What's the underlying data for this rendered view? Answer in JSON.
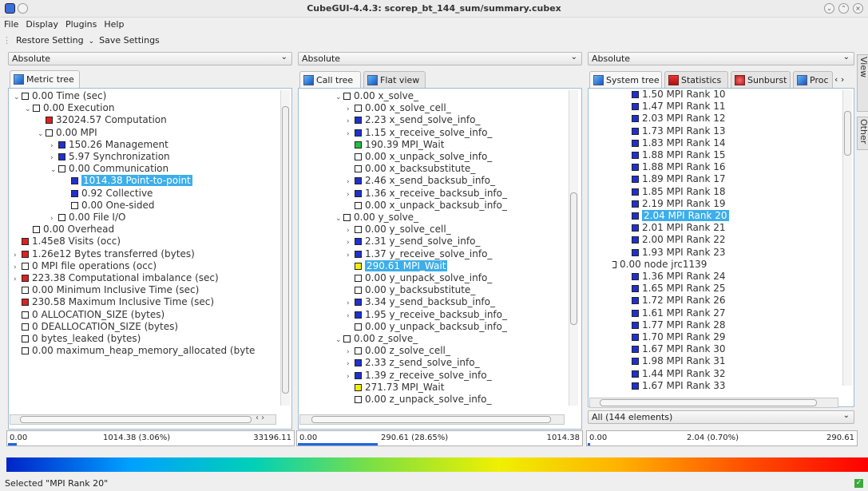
{
  "window": {
    "title": "CubeGUI-4.4.3: scorep_bt_144_sum/summary.cubex"
  },
  "menu": [
    "File",
    "Display",
    "Plugins",
    "Help"
  ],
  "toolbar": {
    "restore": "Restore Setting",
    "save": "Save Settings"
  },
  "left": {
    "selector": "Absolute",
    "tab": "Metric tree",
    "rows": [
      {
        "e": "⌄",
        "c": "#fff",
        "t": "0.00 Time (sec)"
      },
      {
        "e": "⌄",
        "c": "#fff",
        "t": "0.00 Execution"
      },
      {
        "e": "",
        "c": "#e02020",
        "t": "32024.57 Computation"
      },
      {
        "e": "⌄",
        "c": "#fff",
        "t": "0.00 MPI"
      },
      {
        "e": "›",
        "c": "#2030d0",
        "t": "150.26 Management"
      },
      {
        "e": "›",
        "c": "#2030d0",
        "t": "5.97 Synchronization"
      },
      {
        "e": "⌄",
        "c": "#fff",
        "t": "0.00 Communication"
      },
      {
        "e": "",
        "c": "#2030d0",
        "t": "1014.38 Point-to-point",
        "sel": true
      },
      {
        "e": "",
        "c": "#2030d0",
        "t": "0.92 Collective"
      },
      {
        "e": "",
        "c": "#fff",
        "t": "0.00 One-sided"
      },
      {
        "e": "›",
        "c": "#fff",
        "t": "0.00 File I/O"
      },
      {
        "e": "",
        "c": "#fff",
        "t": "0.00 Overhead"
      },
      {
        "e": "",
        "c": "#e02020",
        "t": "1.45e8 Visits (occ)"
      },
      {
        "e": "›",
        "c": "#e02020",
        "t": "1.26e12 Bytes transferred (bytes)"
      },
      {
        "e": "›",
        "c": "#fff",
        "t": "0 MPI file operations (occ)"
      },
      {
        "e": "›",
        "c": "#e02020",
        "t": "223.38 Computational imbalance (sec)"
      },
      {
        "e": "",
        "c": "#fff",
        "t": "0.00 Minimum Inclusive Time (sec)"
      },
      {
        "e": "",
        "c": "#e02020",
        "t": "230.58 Maximum Inclusive Time (sec)"
      },
      {
        "e": "",
        "c": "#fff",
        "t": "0 ALLOCATION_SIZE (bytes)"
      },
      {
        "e": "",
        "c": "#fff",
        "t": "0 DEALLOCATION_SIZE (bytes)"
      },
      {
        "e": "",
        "c": "#fff",
        "t": "0 bytes_leaked (bytes)"
      },
      {
        "e": "",
        "c": "#fff",
        "t": "0.00 maximum_heap_memory_allocated (byte"
      }
    ],
    "bar": {
      "min": "0.00",
      "mid": "1014.38 (3.06%)",
      "max": "33196.11"
    }
  },
  "middle": {
    "selector": "Absolute",
    "tabs": [
      "Call tree",
      "Flat view"
    ],
    "rows": [
      {
        "e": "⌄",
        "c": "#fff",
        "t": "0.00 x_solve_"
      },
      {
        "e": "›",
        "c": "#fff",
        "t": "0.00 x_solve_cell_"
      },
      {
        "e": "›",
        "c": "#2030d0",
        "t": "2.23 x_send_solve_info_"
      },
      {
        "e": "›",
        "c": "#2030d0",
        "t": "1.15 x_receive_solve_info_"
      },
      {
        "e": "",
        "c": "#20c040",
        "t": "190.39 MPI_Wait"
      },
      {
        "e": "",
        "c": "#fff",
        "t": "0.00 x_unpack_solve_info_"
      },
      {
        "e": "",
        "c": "#fff",
        "t": "0.00 x_backsubstitute_"
      },
      {
        "e": "›",
        "c": "#2030d0",
        "t": "2.46 x_send_backsub_info_"
      },
      {
        "e": "›",
        "c": "#2030d0",
        "t": "1.36 x_receive_backsub_info_"
      },
      {
        "e": "",
        "c": "#fff",
        "t": "0.00 x_unpack_backsub_info_"
      },
      {
        "e": "⌄",
        "c": "#fff",
        "t": "0.00 y_solve_"
      },
      {
        "e": "›",
        "c": "#fff",
        "t": "0.00 y_solve_cell_"
      },
      {
        "e": "›",
        "c": "#2030d0",
        "t": "2.31 y_send_solve_info_"
      },
      {
        "e": "›",
        "c": "#2030d0",
        "t": "1.37 y_receive_solve_info_"
      },
      {
        "e": "",
        "c": "#f0f000",
        "t": "290.61 MPI_Wait",
        "sel": true
      },
      {
        "e": "",
        "c": "#fff",
        "t": "0.00 y_unpack_solve_info_"
      },
      {
        "e": "",
        "c": "#fff",
        "t": "0.00 y_backsubstitute_"
      },
      {
        "e": "›",
        "c": "#2030d0",
        "t": "3.34 y_send_backsub_info_"
      },
      {
        "e": "›",
        "c": "#2030d0",
        "t": "1.95 y_receive_backsub_info_"
      },
      {
        "e": "",
        "c": "#fff",
        "t": "0.00 y_unpack_backsub_info_"
      },
      {
        "e": "⌄",
        "c": "#fff",
        "t": "0.00 z_solve_"
      },
      {
        "e": "›",
        "c": "#fff",
        "t": "0.00 z_solve_cell_"
      },
      {
        "e": "›",
        "c": "#2030d0",
        "t": "2.33 z_send_solve_info_"
      },
      {
        "e": "›",
        "c": "#2030d0",
        "t": "1.39 z_receive_solve_info_"
      },
      {
        "e": "",
        "c": "#f0f000",
        "t": "271.73 MPI_Wait"
      },
      {
        "e": "",
        "c": "#fff",
        "t": "0.00 z_unpack_solve_info_"
      }
    ],
    "bar": {
      "min": "0.00",
      "mid": "290.61 (28.65%)",
      "max": "1014.38"
    }
  },
  "right": {
    "selector": "Absolute",
    "tabs": [
      "System tree",
      "Statistics",
      "Sunburst",
      "Proc"
    ],
    "rows": [
      {
        "e": "",
        "c": "#2030d0",
        "t": "1.50 MPI Rank 10"
      },
      {
        "e": "",
        "c": "#2030d0",
        "t": "1.47 MPI Rank 11"
      },
      {
        "e": "",
        "c": "#2030d0",
        "t": "2.03 MPI Rank 12"
      },
      {
        "e": "",
        "c": "#2030d0",
        "t": "1.73 MPI Rank 13"
      },
      {
        "e": "",
        "c": "#2030d0",
        "t": "1.83 MPI Rank 14"
      },
      {
        "e": "",
        "c": "#2030d0",
        "t": "1.88 MPI Rank 15"
      },
      {
        "e": "",
        "c": "#2030d0",
        "t": "1.88 MPI Rank 16"
      },
      {
        "e": "",
        "c": "#2030d0",
        "t": "1.89 MPI Rank 17"
      },
      {
        "e": "",
        "c": "#2030d0",
        "t": "1.85 MPI Rank 18"
      },
      {
        "e": "",
        "c": "#2030d0",
        "t": "2.19 MPI Rank 19"
      },
      {
        "e": "",
        "c": "#2030d0",
        "t": "2.04 MPI Rank 20",
        "sel": true
      },
      {
        "e": "",
        "c": "#2030d0",
        "t": "2.01 MPI Rank 21"
      },
      {
        "e": "",
        "c": "#2030d0",
        "t": "2.00 MPI Rank 22"
      },
      {
        "e": "",
        "c": "#2030d0",
        "t": "1.93 MPI Rank 23"
      },
      {
        "e": "⌄",
        "c": "#fff",
        "t": "0.00 node jrc1139"
      },
      {
        "e": "",
        "c": "#2030d0",
        "t": "1.36 MPI Rank 24"
      },
      {
        "e": "",
        "c": "#2030d0",
        "t": "1.65 MPI Rank 25"
      },
      {
        "e": "",
        "c": "#2030d0",
        "t": "1.72 MPI Rank 26"
      },
      {
        "e": "",
        "c": "#2030d0",
        "t": "1.61 MPI Rank 27"
      },
      {
        "e": "",
        "c": "#2030d0",
        "t": "1.77 MPI Rank 28"
      },
      {
        "e": "",
        "c": "#2030d0",
        "t": "1.70 MPI Rank 29"
      },
      {
        "e": "",
        "c": "#2030d0",
        "t": "1.67 MPI Rank 30"
      },
      {
        "e": "",
        "c": "#2030d0",
        "t": "1.98 MPI Rank 31"
      },
      {
        "e": "",
        "c": "#2030d0",
        "t": "1.44 MPI Rank 32"
      },
      {
        "e": "",
        "c": "#2030d0",
        "t": "1.67 MPI Rank 33"
      }
    ],
    "filter": "All (144 elements)",
    "bar": {
      "min": "0.00",
      "mid": "2.04 (0.70%)",
      "max": "290.61"
    }
  },
  "side_tabs": [
    "System View",
    "Other"
  ],
  "status": "Selected \"MPI Rank 20\""
}
